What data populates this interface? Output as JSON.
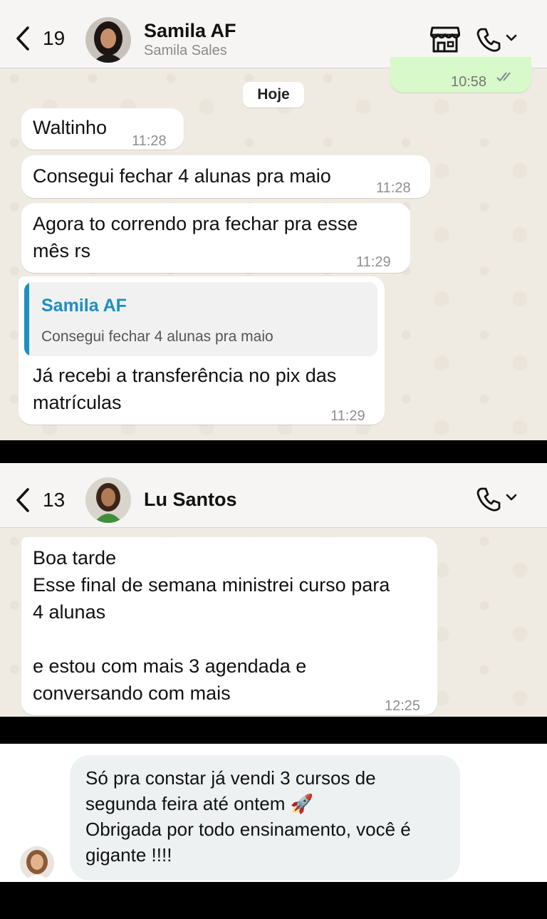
{
  "chat1": {
    "back_count": "19",
    "contact_name": "Samila AF",
    "contact_subtitle": "Samila Sales",
    "icons": [
      "chevron-left-icon",
      "store-icon",
      "phone-icon",
      "chevron-down-icon"
    ],
    "outgoing_time": "10:58",
    "day_label": "Hoje",
    "messages": [
      {
        "text": "Waltinho",
        "time": "11:28"
      },
      {
        "text": "Consegui fechar 4 alunas pra maio",
        "time": "11:28"
      },
      {
        "text": "Agora to correndo pra fechar pra esse\nmês rs",
        "time": "11:29"
      },
      {
        "text": "Já recebi a transferência no pix das\nmatrículas",
        "time": "11:29",
        "quote": {
          "author": "Samila AF",
          "text": "Consegui fechar 4 alunas pra maio"
        }
      }
    ]
  },
  "chat2": {
    "back_count": "13",
    "contact_name": "Lu Santos",
    "icons": [
      "chevron-left-icon",
      "phone-icon",
      "chevron-down-icon"
    ],
    "message": {
      "text": "Boa tarde\nEsse final de semana ministrei curso para\n4 alunas\n\ne estou com mais 3 agendada e\nconversando com mais",
      "time": "12:25"
    }
  },
  "chat3": {
    "message": "Só pra constar já vendi 3 cursos de\nsegunda feira até ontem 🚀\nObrigada por todo ensinamento, você é\ngigante !!!!"
  },
  "colors": {
    "chat_bg": "#efeae2",
    "outgoing_bubble": "#d8f9c9",
    "quote_accent": "#1d8fc2",
    "read_ticks": "#7a8a94",
    "divider": "#000000"
  }
}
